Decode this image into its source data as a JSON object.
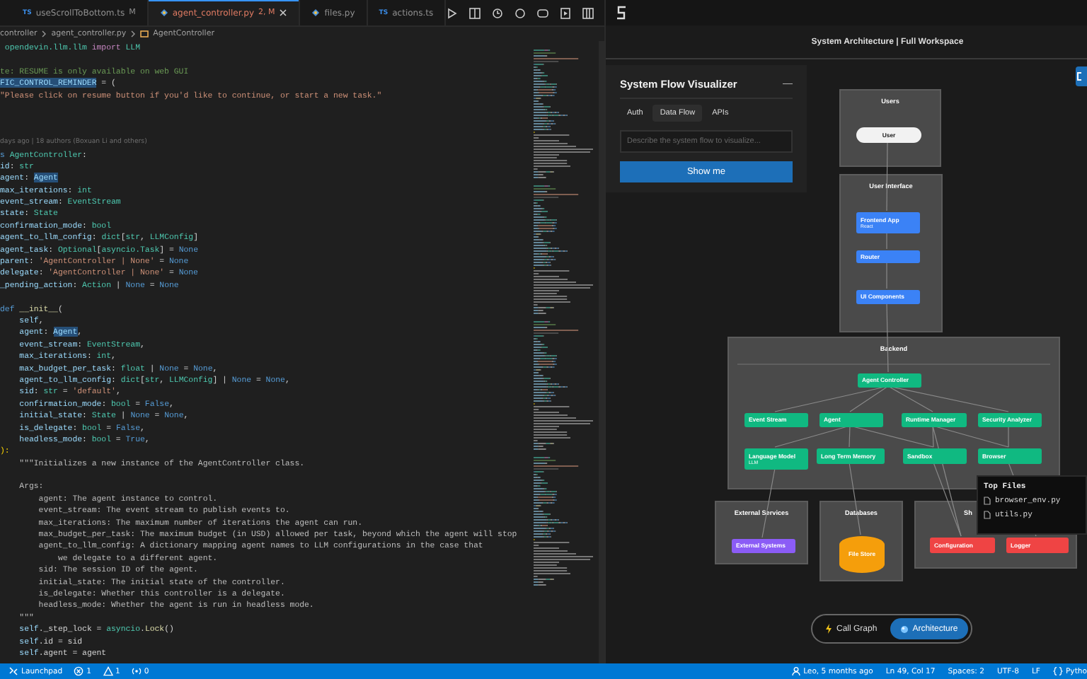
{
  "editor": {
    "tabs": [
      {
        "label": "useScrollToBottom.ts",
        "badge": "M",
        "kind": "ts",
        "icon_label": "TS",
        "selected": false
      },
      {
        "label": "agent_controller.py",
        "badge": "2, M",
        "kind": "py",
        "selected": true
      },
      {
        "label": "files.py",
        "kind": "py",
        "selected": false
      },
      {
        "label": "actions.ts",
        "kind": "ts",
        "icon_label": "TS",
        "selected": false
      }
    ],
    "breadcrumb": [
      "controller",
      "agent_controller.py",
      "AgentController"
    ],
    "code": [
      {
        "lines": [
          {
            "kind": "code",
            "tokens": [
              {
                "text": " opendevin.llm.llm ",
                "kind": "t"
              },
              {
                "text": "import ",
                "kind": "k"
              },
              {
                "text": "LLM",
                "kind": "t"
              }
            ]
          }
        ]
      },
      {
        "lines": [
          {
            "kind": "code",
            "tokens": [
              {
                "text": "te: RESUME is only available on web GUI",
                "kind": "c"
              }
            ]
          },
          {
            "kind": "code",
            "tokens": [
              {
                "text": "FIC_CONTROL_REMINDER",
                "kind": "hl"
              },
              {
                "text": " = (",
                "kind": "p"
              }
            ]
          },
          {
            "kind": "code",
            "tokens": [
              {
                "text": "\"Please click on resume button if you'd like to continue, or start a new task.\"",
                "kind": "s"
              }
            ]
          }
        ]
      },
      {
        "lines": [
          {
            "kind": "blame",
            "tokens": [
              {
                "text": "days ago | 18 authors (Boxuan Li and others)",
                "kind": "b"
              }
            ]
          },
          {
            "kind": "code",
            "tokens": [
              {
                "text": "s ",
                "kind": "n"
              },
              {
                "text": "AgentController",
                "kind": "t"
              },
              {
                "text": ":",
                "kind": "p"
              }
            ]
          },
          {
            "kind": "code",
            "tokens": [
              {
                "text": "id",
                "kind": "v"
              },
              {
                "text": ": ",
                "kind": "p"
              },
              {
                "text": "str",
                "kind": "t"
              }
            ]
          },
          {
            "kind": "code",
            "tokens": [
              {
                "text": "agent",
                "kind": "v"
              },
              {
                "text": ": ",
                "kind": "p"
              },
              {
                "text": "Agent",
                "kind": "hl"
              }
            ]
          },
          {
            "kind": "code",
            "tokens": [
              {
                "text": "max_iterations",
                "kind": "v"
              },
              {
                "text": ": ",
                "kind": "p"
              },
              {
                "text": "int",
                "kind": "t"
              }
            ]
          },
          {
            "kind": "code",
            "tokens": [
              {
                "text": "event_stream",
                "kind": "v"
              },
              {
                "text": ": ",
                "kind": "p"
              },
              {
                "text": "EventStream",
                "kind": "t"
              }
            ]
          },
          {
            "kind": "code",
            "tokens": [
              {
                "text": "state",
                "kind": "v"
              },
              {
                "text": ": ",
                "kind": "p"
              },
              {
                "text": "State",
                "kind": "t"
              }
            ]
          },
          {
            "kind": "code",
            "tokens": [
              {
                "text": "confirmation_mode",
                "kind": "v"
              },
              {
                "text": ": ",
                "kind": "p"
              },
              {
                "text": "bool",
                "kind": "t"
              }
            ]
          },
          {
            "kind": "code",
            "tokens": [
              {
                "text": "agent_to_llm_config",
                "kind": "v"
              },
              {
                "text": ": ",
                "kind": "p"
              },
              {
                "text": "dict",
                "kind": "t"
              },
              {
                "text": "[",
                "kind": "p"
              },
              {
                "text": "str",
                "kind": "t"
              },
              {
                "text": ", ",
                "kind": "p"
              },
              {
                "text": "LLMConfig",
                "kind": "t"
              },
              {
                "text": "]",
                "kind": "p"
              }
            ]
          },
          {
            "kind": "code",
            "tokens": [
              {
                "text": "agent_task",
                "kind": "v"
              },
              {
                "text": ": ",
                "kind": "p"
              },
              {
                "text": "Optional",
                "kind": "t"
              },
              {
                "text": "[",
                "kind": "p"
              },
              {
                "text": "asyncio.Task",
                "kind": "t"
              },
              {
                "text": "] = ",
                "kind": "p"
              },
              {
                "text": "None",
                "kind": "n"
              }
            ]
          },
          {
            "kind": "code",
            "tokens": [
              {
                "text": "parent",
                "kind": "v"
              },
              {
                "text": ": ",
                "kind": "p"
              },
              {
                "text": "'AgentController | None'",
                "kind": "s"
              },
              {
                "text": " = ",
                "kind": "p"
              },
              {
                "text": "None",
                "kind": "n"
              }
            ]
          },
          {
            "kind": "code",
            "tokens": [
              {
                "text": "delegate",
                "kind": "v"
              },
              {
                "text": ": ",
                "kind": "p"
              },
              {
                "text": "'AgentController | None'",
                "kind": "s"
              },
              {
                "text": " = ",
                "kind": "p"
              },
              {
                "text": "None",
                "kind": "n"
              }
            ]
          },
          {
            "kind": "code",
            "tokens": [
              {
                "text": "_pending_action",
                "kind": "v"
              },
              {
                "text": ": ",
                "kind": "p"
              },
              {
                "text": "Action",
                "kind": "t"
              },
              {
                "text": " | ",
                "kind": "p"
              },
              {
                "text": "None",
                "kind": "n"
              },
              {
                "text": " = ",
                "kind": "p"
              },
              {
                "text": "None",
                "kind": "n"
              }
            ]
          }
        ]
      },
      {
        "lines": [
          {
            "kind": "code",
            "tokens": [
              {
                "text": "def ",
                "kind": "n"
              },
              {
                "text": "__init__",
                "kind": "f"
              },
              {
                "text": "(",
                "kind": "p"
              }
            ]
          },
          {
            "kind": "code",
            "tokens": [
              {
                "text": "    self",
                "kind": "v"
              },
              {
                "text": ",",
                "kind": "p"
              }
            ]
          },
          {
            "kind": "code",
            "tokens": [
              {
                "text": "    agent",
                "kind": "v"
              },
              {
                "text": ": ",
                "kind": "p"
              },
              {
                "text": "Agent",
                "kind": "hl"
              },
              {
                "text": ",",
                "kind": "p"
              }
            ]
          },
          {
            "kind": "code",
            "tokens": [
              {
                "text": "    event_stream",
                "kind": "v"
              },
              {
                "text": ": ",
                "kind": "p"
              },
              {
                "text": "EventStream",
                "kind": "t"
              },
              {
                "text": ",",
                "kind": "p"
              }
            ]
          },
          {
            "kind": "code",
            "tokens": [
              {
                "text": "    max_iterations",
                "kind": "v"
              },
              {
                "text": ": ",
                "kind": "p"
              },
              {
                "text": "int",
                "kind": "t"
              },
              {
                "text": ",",
                "kind": "p"
              }
            ]
          },
          {
            "kind": "code",
            "tokens": [
              {
                "text": "    max_budget_per_task",
                "kind": "v"
              },
              {
                "text": ": ",
                "kind": "p"
              },
              {
                "text": "float",
                "kind": "t"
              },
              {
                "text": " | ",
                "kind": "p"
              },
              {
                "text": "None",
                "kind": "n"
              },
              {
                "text": " = ",
                "kind": "p"
              },
              {
                "text": "None",
                "kind": "n"
              },
              {
                "text": ",",
                "kind": "p"
              }
            ]
          },
          {
            "kind": "code",
            "tokens": [
              {
                "text": "    agent_to_llm_config",
                "kind": "v"
              },
              {
                "text": ": ",
                "kind": "p"
              },
              {
                "text": "dict",
                "kind": "t"
              },
              {
                "text": "[",
                "kind": "p"
              },
              {
                "text": "str",
                "kind": "t"
              },
              {
                "text": ", ",
                "kind": "p"
              },
              {
                "text": "LLMConfig",
                "kind": "t"
              },
              {
                "text": "] | ",
                "kind": "p"
              },
              {
                "text": "None",
                "kind": "n"
              },
              {
                "text": " = ",
                "kind": "p"
              },
              {
                "text": "None",
                "kind": "n"
              },
              {
                "text": ",",
                "kind": "p"
              }
            ]
          },
          {
            "kind": "code",
            "tokens": [
              {
                "text": "    sid",
                "kind": "v"
              },
              {
                "text": ": ",
                "kind": "p"
              },
              {
                "text": "str",
                "kind": "t"
              },
              {
                "text": " = ",
                "kind": "p"
              },
              {
                "text": "'default'",
                "kind": "s"
              },
              {
                "text": ",",
                "kind": "p"
              }
            ]
          },
          {
            "kind": "code",
            "tokens": [
              {
                "text": "    confirmation_mode",
                "kind": "v"
              },
              {
                "text": ": ",
                "kind": "p"
              },
              {
                "text": "bool",
                "kind": "t"
              },
              {
                "text": " = ",
                "kind": "p"
              },
              {
                "text": "False",
                "kind": "n"
              },
              {
                "text": ",",
                "kind": "p"
              }
            ]
          },
          {
            "kind": "code",
            "tokens": [
              {
                "text": "    initial_state",
                "kind": "v"
              },
              {
                "text": ": ",
                "kind": "p"
              },
              {
                "text": "State",
                "kind": "t"
              },
              {
                "text": " | ",
                "kind": "p"
              },
              {
                "text": "None",
                "kind": "n"
              },
              {
                "text": " = ",
                "kind": "p"
              },
              {
                "text": "None",
                "kind": "n"
              },
              {
                "text": ",",
                "kind": "p"
              }
            ]
          },
          {
            "kind": "code",
            "tokens": [
              {
                "text": "    is_delegate",
                "kind": "v"
              },
              {
                "text": ": ",
                "kind": "p"
              },
              {
                "text": "bool",
                "kind": "t"
              },
              {
                "text": " = ",
                "kind": "p"
              },
              {
                "text": "False",
                "kind": "n"
              },
              {
                "text": ",",
                "kind": "p"
              }
            ]
          },
          {
            "kind": "code",
            "tokens": [
              {
                "text": "    headless_mode",
                "kind": "v"
              },
              {
                "text": ": ",
                "kind": "p"
              },
              {
                "text": "bool",
                "kind": "t"
              },
              {
                "text": " = ",
                "kind": "p"
              },
              {
                "text": "True",
                "kind": "n"
              },
              {
                "text": ",",
                "kind": "p"
              }
            ]
          },
          {
            "kind": "code",
            "tokens": [
              {
                "text": "):",
                "kind": "y"
              }
            ]
          },
          {
            "kind": "code",
            "tokens": [
              {
                "text": "    \"\"\"Initializes a new instance of the AgentController class.",
                "kind": "d"
              }
            ]
          }
        ]
      },
      {
        "lines": [
          {
            "kind": "code",
            "tokens": [
              {
                "text": "    Args:",
                "kind": "d"
              }
            ]
          },
          {
            "kind": "code",
            "tokens": [
              {
                "text": "        agent: The agent instance to control.",
                "kind": "d"
              }
            ]
          },
          {
            "kind": "code",
            "tokens": [
              {
                "text": "        event_stream: The event stream to publish events to.",
                "kind": "d"
              }
            ]
          },
          {
            "kind": "code",
            "tokens": [
              {
                "text": "        max_iterations: The maximum number of iterations the agent can run.",
                "kind": "d"
              }
            ]
          },
          {
            "kind": "code",
            "tokens": [
              {
                "text": "        max_budget_per_task: The maximum budget (in USD) allowed per task, beyond which the agent will stop",
                "kind": "d"
              }
            ]
          },
          {
            "kind": "code",
            "tokens": [
              {
                "text": "        agent_to_llm_config: A dictionary mapping agent names to LLM configurations in the case that",
                "kind": "d"
              }
            ]
          },
          {
            "kind": "code",
            "tokens": [
              {
                "text": "            we delegate to a different agent.",
                "kind": "d"
              }
            ]
          },
          {
            "kind": "code",
            "tokens": [
              {
                "text": "        sid: The session ID of the agent.",
                "kind": "d"
              }
            ]
          },
          {
            "kind": "code",
            "tokens": [
              {
                "text": "        initial_state: The initial state of the controller.",
                "kind": "d"
              }
            ]
          },
          {
            "kind": "code",
            "tokens": [
              {
                "text": "        is_delegate: Whether this controller is a delegate.",
                "kind": "d"
              }
            ]
          },
          {
            "kind": "code",
            "tokens": [
              {
                "text": "        headless_mode: Whether the agent is run in headless mode.",
                "kind": "d"
              }
            ]
          },
          {
            "kind": "code",
            "tokens": [
              {
                "text": "    \"\"\"",
                "kind": "d"
              }
            ]
          },
          {
            "kind": "code",
            "tokens": [
              {
                "text": "    self",
                "kind": "v"
              },
              {
                "text": "._step_lock = ",
                "kind": "p"
              },
              {
                "text": "asyncio",
                "kind": "t"
              },
              {
                "text": ".",
                "kind": "p"
              },
              {
                "text": "Lock",
                "kind": "f"
              },
              {
                "text": "()",
                "kind": "p"
              }
            ]
          },
          {
            "kind": "code",
            "tokens": [
              {
                "text": "    self",
                "kind": "v"
              },
              {
                "text": ".id = sid",
                "kind": "p"
              }
            ]
          },
          {
            "kind": "code",
            "tokens": [
              {
                "text": "    self",
                "kind": "v"
              },
              {
                "text": ".agent = agent",
                "kind": "p"
              }
            ]
          }
        ]
      }
    ]
  },
  "right_panel": {
    "title": "System Architecture | Full Workspace",
    "visualizer": {
      "title": "System Flow Visualizer",
      "minimize": "—",
      "tabs": [
        {
          "label": "Auth",
          "selected": false
        },
        {
          "label": "Data Flow",
          "selected": true
        },
        {
          "label": "APIs",
          "selected": false
        }
      ],
      "input": {
        "placeholder": "Describe the system flow to visualize..."
      },
      "button": "Show me"
    },
    "diagram": {
      "groups": [
        {
          "title": "Users",
          "nodes": [
            {
              "label": "User",
              "kind": "pill",
              "color": "#f2f2f2"
            }
          ]
        },
        {
          "title": "User Interface",
          "nodes": [
            {
              "label": "Frontend App",
              "sublabel": "React",
              "kind": "box",
              "color": "#3b82f6"
            },
            {
              "label": "Router",
              "kind": "box",
              "color": "#3b82f6"
            },
            {
              "label": "UI Components",
              "kind": "box",
              "color": "#3b82f6"
            }
          ]
        },
        {
          "title": "Backend",
          "nodes": [
            {
              "label": "Agent Controller",
              "kind": "box",
              "color": "#10b981"
            },
            {
              "label": "Event Stream",
              "kind": "box",
              "color": "#10b981"
            },
            {
              "label": "Agent",
              "kind": "box",
              "color": "#10b981"
            },
            {
              "label": "Runtime Manager",
              "kind": "box",
              "color": "#10b981"
            },
            {
              "label": "Security Analyzer",
              "kind": "box",
              "color": "#10b981"
            },
            {
              "label": "Language Model",
              "sublabel": "LLM",
              "kind": "box",
              "color": "#10b981"
            },
            {
              "label": "Long Term Memory",
              "kind": "box",
              "color": "#10b981"
            },
            {
              "label": "Sandbox",
              "kind": "box",
              "color": "#10b981"
            },
            {
              "label": "Browser",
              "kind": "box",
              "color": "#10b981"
            }
          ]
        },
        {
          "title": "External Services",
          "nodes": [
            {
              "label": "External Systems",
              "kind": "box",
              "color": "#8b5cf6"
            }
          ]
        },
        {
          "title": "Databases",
          "nodes": [
            {
              "label": "File Store",
              "kind": "cylinder",
              "color": "#f59e0b"
            }
          ]
        },
        {
          "title": "Sh",
          "nodes": [
            {
              "label": "Configuration",
              "kind": "box",
              "color": "#ef4444"
            },
            {
              "label": "Logger",
              "kind": "box",
              "color": "#ef4444"
            }
          ]
        }
      ]
    },
    "tooltip": {
      "title": "Top Files",
      "files": [
        "browser_env.py",
        "utils.py"
      ]
    },
    "view_toggle": [
      {
        "label": "Call Graph",
        "kind": "call-graph",
        "selected": false
      },
      {
        "label": "Architecture",
        "kind": "architecture",
        "selected": true
      }
    ]
  },
  "status_bar": {
    "left": [
      {
        "kind": "remote",
        "text": "Launchpad"
      },
      {
        "kind": "errors",
        "text": "1"
      },
      {
        "kind": "warnings",
        "text": "1"
      },
      {
        "kind": "ports",
        "text": "0"
      }
    ],
    "right": [
      {
        "kind": "blame",
        "text": "Leo, 5 months ago"
      },
      {
        "kind": "text",
        "text": "Ln 49, Col 17"
      },
      {
        "kind": "text",
        "text": "Spaces: 2"
      },
      {
        "kind": "text",
        "text": "UTF-8"
      },
      {
        "kind": "text",
        "text": "LF"
      },
      {
        "kind": "language",
        "text": "Pytho"
      }
    ]
  }
}
